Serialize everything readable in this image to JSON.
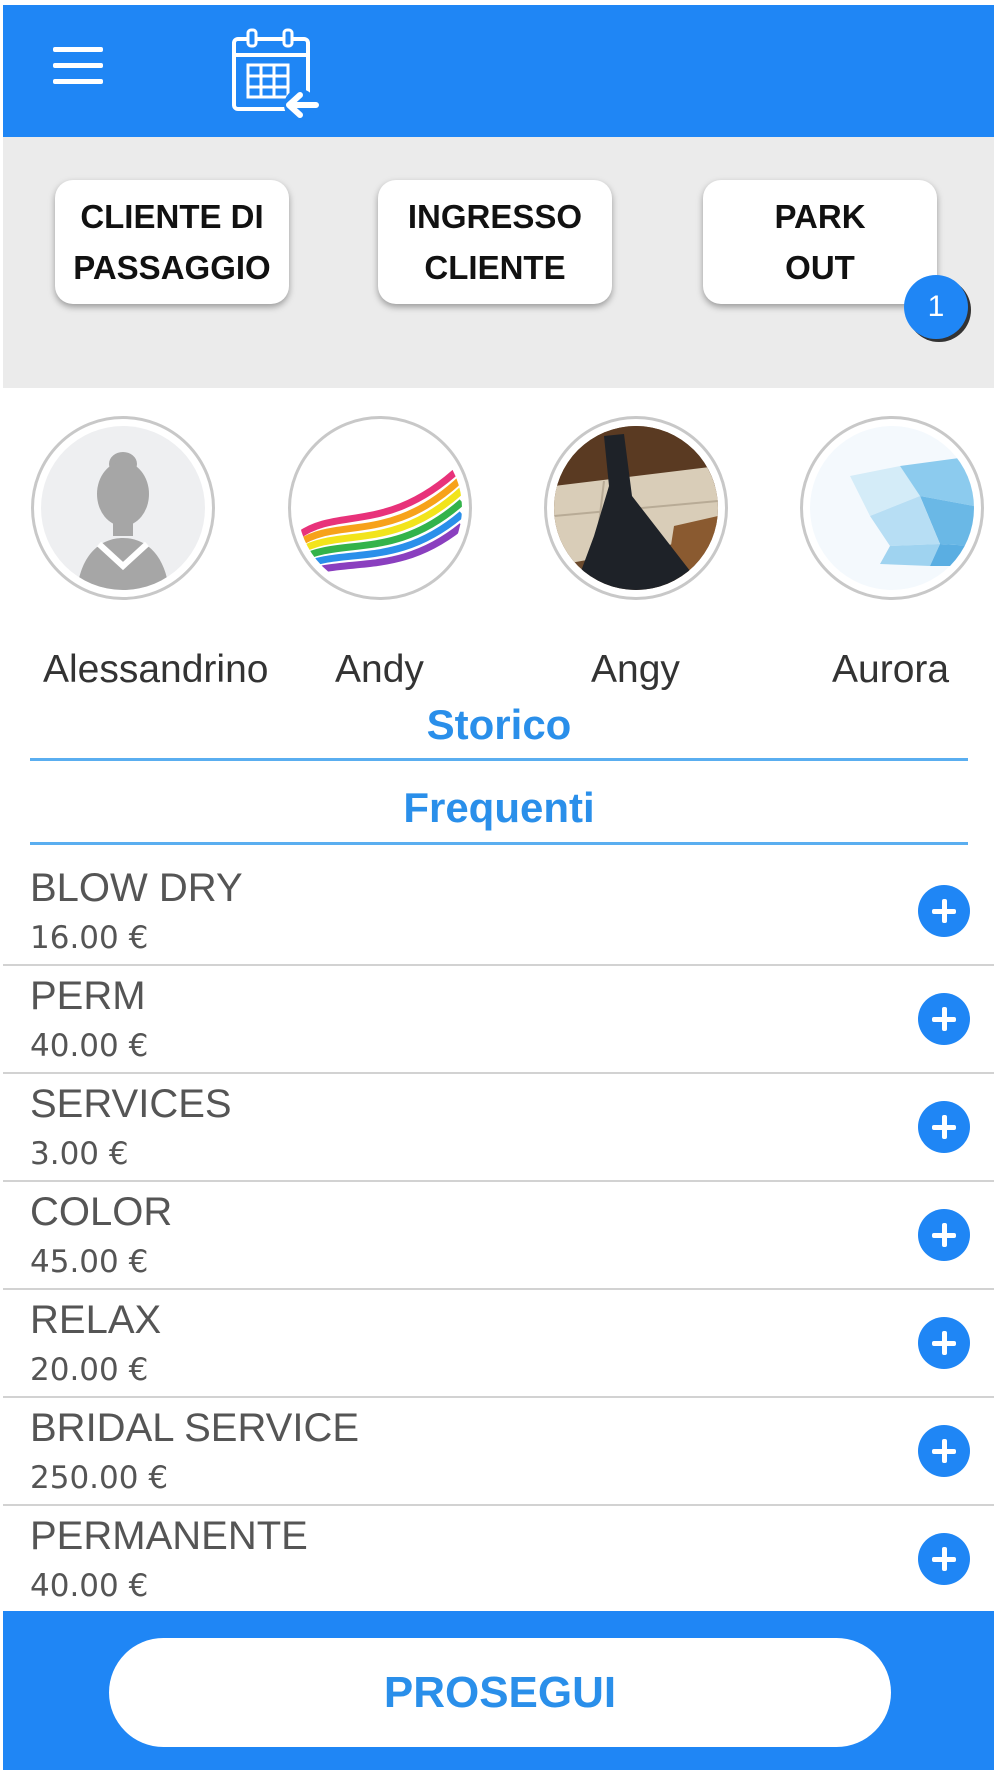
{
  "colors": {
    "primary": "#1f86f5",
    "accent_text": "#2a8fea",
    "bar_bg": "#ebebeb"
  },
  "header": {
    "menu_icon": "hamburger-menu-icon",
    "calendar_icon": "calendar-arrow-icon"
  },
  "actions": [
    {
      "label": "CLIENTE DI\nPASSAGGIO"
    },
    {
      "label": "INGRESSO\nCLIENTE"
    },
    {
      "label": "PARK\nOUT",
      "badge": "1"
    }
  ],
  "customers": [
    {
      "name": "Alessandrino",
      "avatar": "default-silhouette"
    },
    {
      "name": "Andy",
      "avatar": "rainbow-swirl"
    },
    {
      "name": "Angy",
      "avatar": "photo"
    },
    {
      "name": "Aurora",
      "avatar": "blue-polygons"
    }
  ],
  "sections": {
    "history": "Storico",
    "frequent": "Frequenti"
  },
  "services": [
    {
      "name": "BLOW DRY",
      "price": "16.00 €"
    },
    {
      "name": "PERM",
      "price": "40.00 €"
    },
    {
      "name": "SERVICES",
      "price": "3.00 €"
    },
    {
      "name": "COLOR",
      "price": "45.00 €"
    },
    {
      "name": "RELAX",
      "price": "20.00 €"
    },
    {
      "name": "BRIDAL SERVICE",
      "price": "250.00 €"
    },
    {
      "name": "PERMANENTE",
      "price": "40.00 €"
    }
  ],
  "footer": {
    "continue_label": "PROSEGUI"
  }
}
